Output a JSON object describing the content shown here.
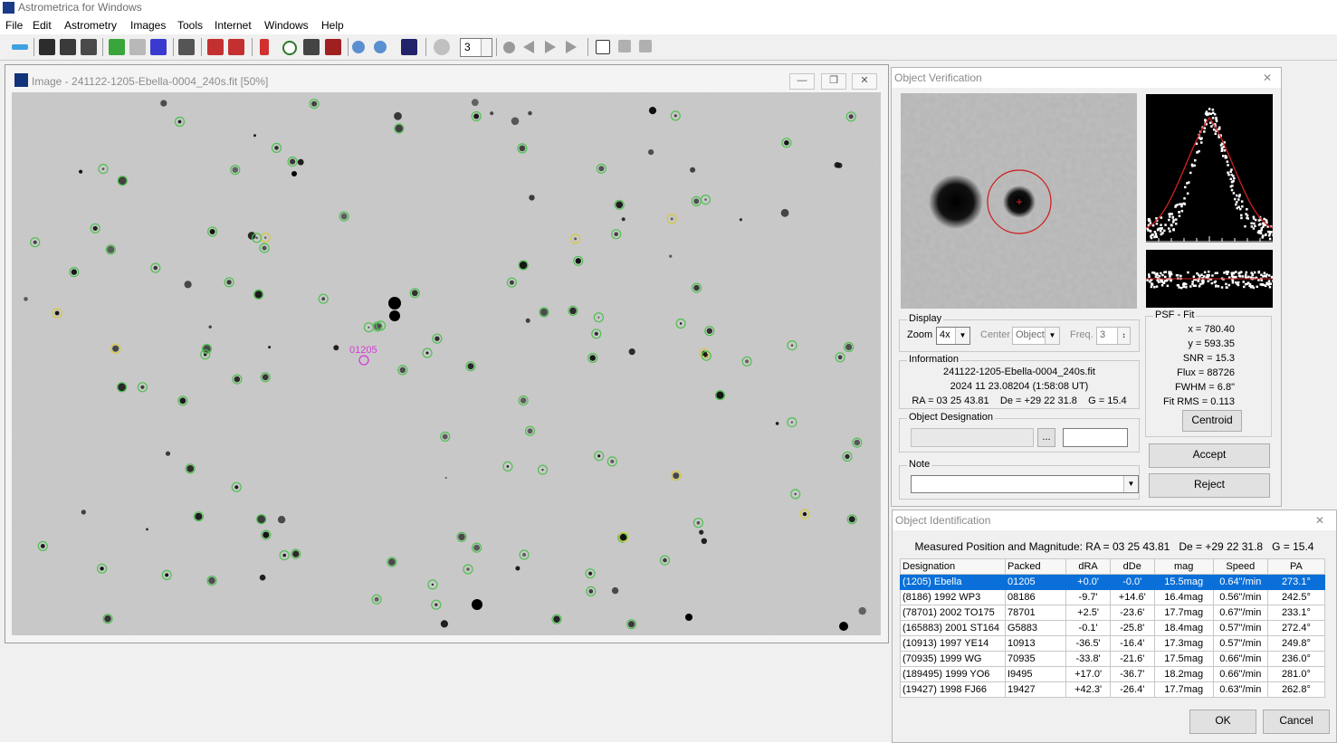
{
  "app": {
    "title": "Astrometrica for Windows"
  },
  "menu": [
    "File",
    "Edit",
    "Astrometry",
    "Images",
    "Tools",
    "Internet",
    "Windows",
    "Help"
  ],
  "toolbar": {
    "frame_number": "3"
  },
  "image_window": {
    "title": "Image - 241122-1205-Ebella-0004_240s.fit [50%]",
    "object_label": "01205",
    "colors": {
      "known_star": "#4fc14f",
      "ref_star": "#d6c83a",
      "target": "#d63cd6"
    }
  },
  "verification": {
    "title": "Object Verification",
    "display": {
      "group_label": "Display",
      "zoom_label": "Zoom",
      "zoom_value": "4x",
      "center_label": "Center",
      "center_value": "Object",
      "freq_label": "Freq.",
      "freq_value": "3"
    },
    "information": {
      "group_label": "Information",
      "filename": "241122-1205-Ebella-0004_240s.fit",
      "time": "2024 11 23.08204 (1:58:08 UT)",
      "coords": "RA = 03 25 43.81    De = +29 22 31.8    G = 15.4"
    },
    "designation": {
      "group_label": "Object Designation",
      "browse_label": "..."
    },
    "note": {
      "group_label": "Note"
    },
    "psf": {
      "group_label": "PSF - Fit",
      "x": "x = 780.40",
      "y": "y = 593.35",
      "snr": "SNR = 15.3",
      "flux": "Flux = 88726",
      "fwhm": "FWHM = 6.8\"",
      "fit_rms": "Fit RMS = 0.113",
      "centroid_label": "Centroid"
    },
    "accept_label": "Accept",
    "reject_label": "Reject"
  },
  "identification": {
    "title": "Object Identification",
    "summary": "Measured Position and Magnitude: RA = 03 25 43.81   De = +29 22 31.8   G = 15.4",
    "columns": [
      "Designation",
      "Packed",
      "dRA",
      "dDe",
      "mag",
      "Speed",
      "PA"
    ],
    "rows": [
      [
        "(1205) Ebella",
        "01205",
        "+0.0'",
        "-0.0'",
        "15.5mag",
        "0.64\"/min",
        "273.1°"
      ],
      [
        "(8186) 1992 WP3",
        "08186",
        "-9.7'",
        "+14.6'",
        "16.4mag",
        "0.56\"/min",
        "242.5°"
      ],
      [
        "(78701) 2002 TO175",
        "78701",
        "+2.5'",
        "-23.6'",
        "17.7mag",
        "0.67\"/min",
        "233.1°"
      ],
      [
        "(165883) 2001 ST164",
        "G5883",
        "-0.1'",
        "-25.8'",
        "18.4mag",
        "0.57\"/min",
        "272.4°"
      ],
      [
        "(10913) 1997 YE14",
        "10913",
        "-36.5'",
        "-16.4'",
        "17.3mag",
        "0.57\"/min",
        "249.8°"
      ],
      [
        "(70935) 1999 WG",
        "70935",
        "-33.8'",
        "-21.6'",
        "17.5mag",
        "0.66\"/min",
        "236.0°"
      ],
      [
        "(189495) 1999 YO6",
        "I9495",
        "+17.0'",
        "-36.7'",
        "18.2mag",
        "0.66\"/min",
        "281.0°"
      ],
      [
        "(19427) 1998 FJ66",
        "19427",
        "+42.3'",
        "-26.4'",
        "17.7mag",
        "0.63\"/min",
        "262.8°"
      ]
    ],
    "ok_label": "OK",
    "cancel_label": "Cancel"
  }
}
